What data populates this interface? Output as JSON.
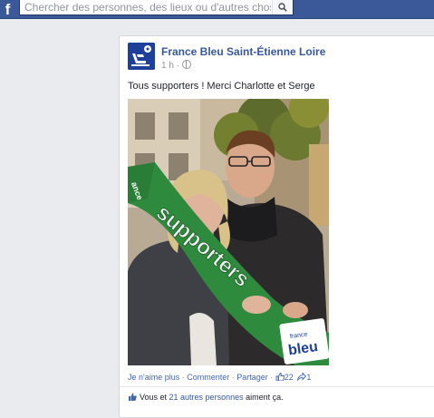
{
  "topbar": {
    "logo": "f",
    "search_placeholder": "Chercher des personnes, des lieux ou d'autres choses",
    "brand_color": "#3b5998"
  },
  "post": {
    "page_name": "France Bleu Saint-Étienne Loire",
    "time": "1 h ·",
    "text": "Tous supporters ! Merci Charlotte et Serge ",
    "photo": {
      "scarf_text": "supporters",
      "scarf_logo_top": "france",
      "scarf_logo_bottom": "bleu",
      "scarf_edge_text": "ance"
    },
    "actions": {
      "unlike": "Je n'aime plus",
      "sep1": " · ",
      "comment": "Commenter",
      "sep2": " · ",
      "share": "Partager",
      "sep3": " · ",
      "like_count": "22",
      "share_count": "1"
    },
    "likes_summary": {
      "prefix": "Vous et ",
      "others": "21 autres personnes",
      "suffix": " aiment ça."
    }
  }
}
